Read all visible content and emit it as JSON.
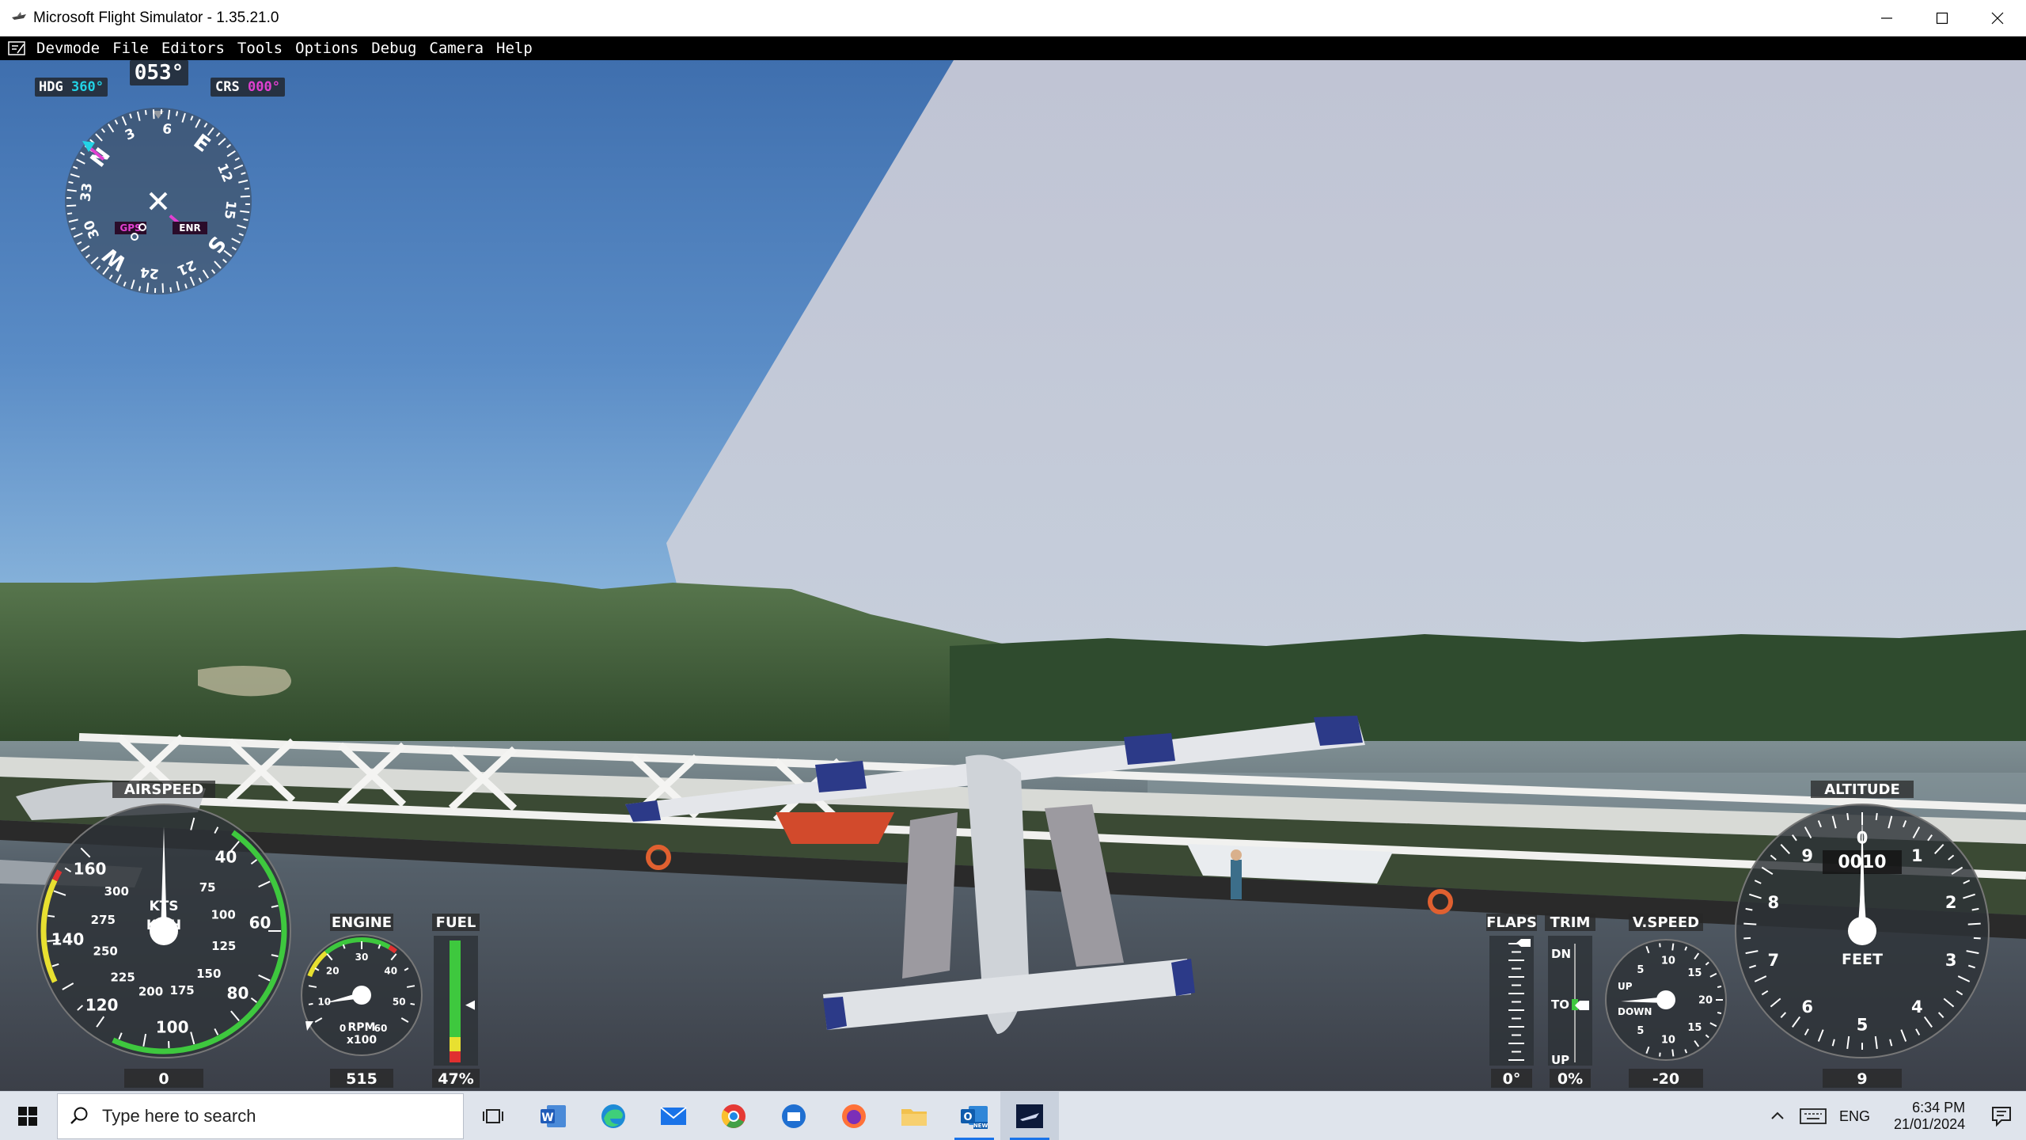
{
  "window": {
    "title": "Microsoft Flight Simulator - 1.35.21.0",
    "icon": "mfs-app-icon"
  },
  "menu": {
    "items": [
      "Devmode",
      "File",
      "Editors",
      "Tools",
      "Options",
      "Debug",
      "Camera",
      "Help"
    ]
  },
  "hud": {
    "compass": {
      "heading_readout": "053°",
      "hdg_label": "HDG",
      "hdg_value": "360°",
      "crs_label": "CRS",
      "crs_value": "000°",
      "gps_label": "GPS",
      "enr_label": "ENR",
      "cardinals": [
        "N",
        "3",
        "6",
        "E",
        "12",
        "15",
        "S",
        "21",
        "24",
        "W",
        "30",
        "33"
      ]
    },
    "airspeed": {
      "title": "AIRSPEED",
      "unit_top": "KTS",
      "unit_bottom": "KMH",
      "outer_ticks": [
        "40",
        "60",
        "80",
        "100",
        "120",
        "140",
        "160"
      ],
      "inner_ticks": [
        "75",
        "100",
        "125",
        "150",
        "175",
        "200",
        "225",
        "250",
        "275",
        "300"
      ],
      "value": "0"
    },
    "engine": {
      "title": "ENGINE",
      "ticks": [
        "0",
        "10",
        "20",
        "30",
        "40",
        "50",
        "60"
      ],
      "unit": "RPM",
      "unit2": "x100",
      "value": "515"
    },
    "fuel": {
      "title": "FUEL",
      "value": "47%",
      "level": 0.47
    },
    "flaps": {
      "title": "FLAPS",
      "value": "0°"
    },
    "trim": {
      "title": "TRIM",
      "dn": "DN",
      "to": "TO",
      "up": "UP",
      "value": "0%"
    },
    "vspeed": {
      "title": "V.SPEED",
      "ticks": [
        "5",
        "10",
        "15",
        "20",
        "15",
        "10",
        "5"
      ],
      "up": "UP",
      "down": "DOWN",
      "value": "-20"
    },
    "altitude": {
      "title": "ALTITUDE",
      "ticks": [
        "0",
        "1",
        "2",
        "3",
        "4",
        "5",
        "6",
        "7",
        "8",
        "9"
      ],
      "unit": "FEET",
      "drum": "0010",
      "value": "9"
    }
  },
  "taskbar": {
    "search_placeholder": "Type here to search",
    "apps": [
      "task-view",
      "word",
      "edge",
      "mail",
      "chrome",
      "thunderbird",
      "firefox",
      "file-explorer",
      "outlook-new",
      "flight-simulator"
    ],
    "language": "ENG",
    "time": "6:34 PM",
    "date": "21/01/2024"
  },
  "colors": {
    "hud_magenta": "#e040d0",
    "hud_cyan": "#22d3e6",
    "gauge_green": "#3ec83e",
    "gauge_yellow": "#e8e030",
    "gauge_red": "#e03030",
    "taskbar_accent": "#1a73e8"
  }
}
